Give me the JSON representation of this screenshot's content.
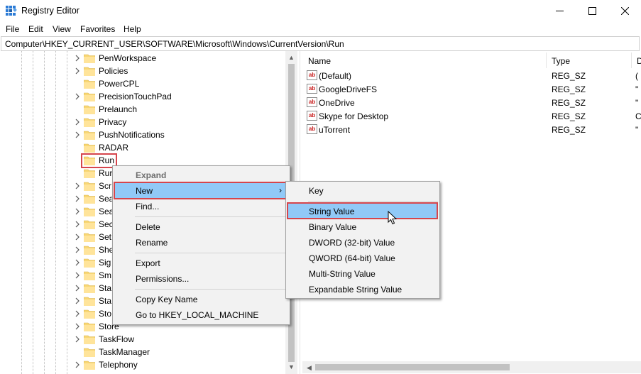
{
  "window": {
    "title": "Registry Editor",
    "minimize_glyph": "minimize-icon",
    "maximize_glyph": "maximize-icon",
    "close_glyph": "close-icon"
  },
  "menu": [
    "File",
    "Edit",
    "View",
    "Favorites",
    "Help"
  ],
  "address": "Computer\\HKEY_CURRENT_USER\\SOFTWARE\\Microsoft\\Windows\\CurrentVersion\\Run",
  "tree": {
    "items": [
      {
        "label": "PenWorkspace",
        "expandable": true
      },
      {
        "label": "Policies",
        "expandable": true
      },
      {
        "label": "PowerCPL",
        "expandable": false
      },
      {
        "label": "PrecisionTouchPad",
        "expandable": true
      },
      {
        "label": "Prelaunch",
        "expandable": false
      },
      {
        "label": "Privacy",
        "expandable": true
      },
      {
        "label": "PushNotifications",
        "expandable": true
      },
      {
        "label": "RADAR",
        "expandable": false
      },
      {
        "label": "Run",
        "expandable": false,
        "selected": true
      },
      {
        "label": "Rur",
        "expandable": false
      },
      {
        "label": "Scr",
        "expandable": true
      },
      {
        "label": "Sea",
        "expandable": true
      },
      {
        "label": "Sea",
        "expandable": true
      },
      {
        "label": "Sec",
        "expandable": true
      },
      {
        "label": "Set",
        "expandable": true
      },
      {
        "label": "She",
        "expandable": true
      },
      {
        "label": "Sig",
        "expandable": true
      },
      {
        "label": "Sm",
        "expandable": true
      },
      {
        "label": "Sta",
        "expandable": true
      },
      {
        "label": "Sta",
        "expandable": true
      },
      {
        "label": "Sto",
        "expandable": true
      },
      {
        "label": "Store",
        "expandable": true
      },
      {
        "label": "TaskFlow",
        "expandable": true
      },
      {
        "label": "TaskManager",
        "expandable": false
      },
      {
        "label": "Telephony",
        "expandable": true
      }
    ]
  },
  "list": {
    "columns": [
      "Name",
      "Type",
      "D"
    ],
    "rows": [
      {
        "name": "(Default)",
        "type": "REG_SZ",
        "data": "("
      },
      {
        "name": "GoogleDriveFS",
        "type": "REG_SZ",
        "data": "\""
      },
      {
        "name": "OneDrive",
        "type": "REG_SZ",
        "data": "\""
      },
      {
        "name": "Skype for Desktop",
        "type": "REG_SZ",
        "data": "C"
      },
      {
        "name": "uTorrent",
        "type": "REG_SZ",
        "data": "\""
      }
    ]
  },
  "context_menu": {
    "items": [
      "Expand",
      "New",
      "Find...",
      "Delete",
      "Rename",
      "Export",
      "Permissions...",
      "Copy Key Name",
      "Go to HKEY_LOCAL_MACHINE"
    ],
    "highlighted": "New"
  },
  "submenu": {
    "items": [
      "Key",
      "String Value",
      "Binary Value",
      "DWORD (32-bit) Value",
      "QWORD (64-bit) Value",
      "Multi-String Value",
      "Expandable String Value"
    ],
    "highlighted": "String Value"
  },
  "colors": {
    "highlight": "#91c9f7",
    "annotation_red": "#d6454c",
    "folder_yellow": "#f8d775"
  }
}
